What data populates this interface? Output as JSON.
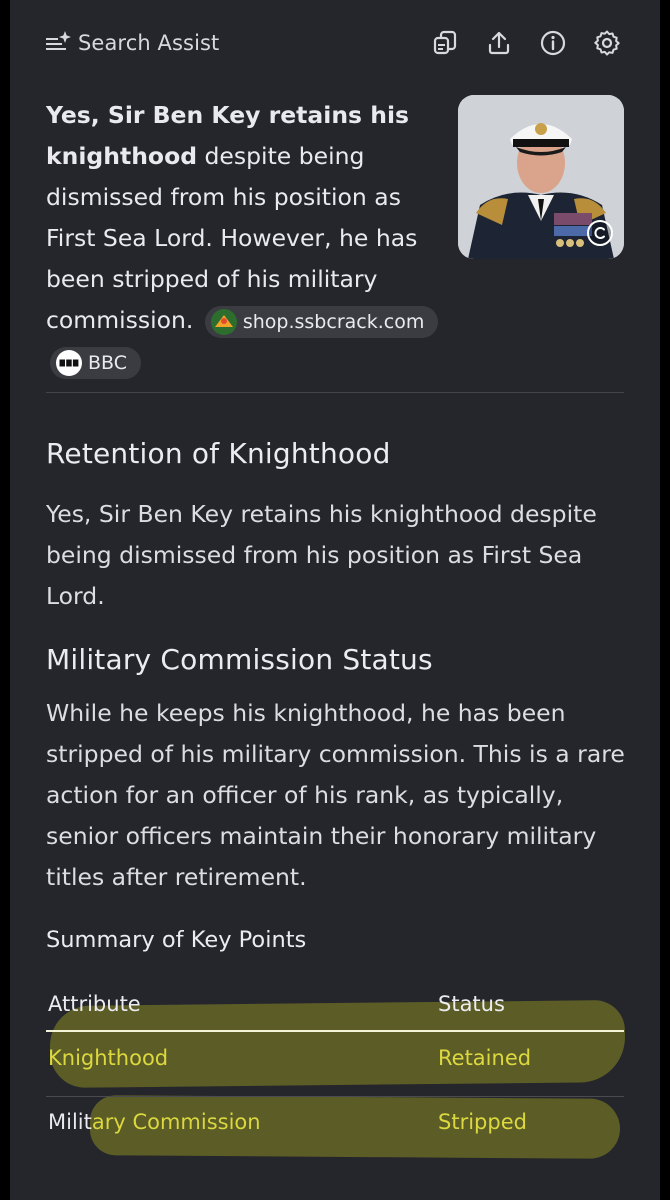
{
  "header": {
    "title": "Search Assist",
    "icons": [
      "sparkle-list-icon",
      "copy-icon",
      "share-icon",
      "info-icon",
      "settings-icon"
    ]
  },
  "intro": {
    "bold": "Yes, Sir Ben Key retains his knighthood",
    "text": " despite being dismissed from his position as First Sea Lord. However, he has been stripped of his military commission. ",
    "citations": [
      {
        "label": "shop.ssbcrack.com",
        "icon": "ssbcrack-favicon"
      },
      {
        "label": "BBC",
        "icon": "bbc-favicon"
      }
    ],
    "image_badge": "copyright-icon"
  },
  "sections": [
    {
      "heading": "Retention of Knighthood",
      "body": "Yes, Sir Ben Key retains his knighthood despite being dismissed from his position as First Sea Lord."
    },
    {
      "heading": "Military Commission Status",
      "body": "While he keeps his knighthood, he has been stripped of his military commission. This is a rare action for an officer of his rank, as typically, senior officers maintain their honorary military titles after retirement."
    }
  ],
  "summary": {
    "heading": "Summary of Key Points",
    "columns": [
      "Attribute",
      "Status"
    ],
    "rows": [
      [
        "Knighthood",
        "Retained"
      ],
      [
        "Military Commission",
        "Stripped"
      ]
    ]
  },
  "colors": {
    "background": "#25262b",
    "highlight": "#dcd83f"
  }
}
